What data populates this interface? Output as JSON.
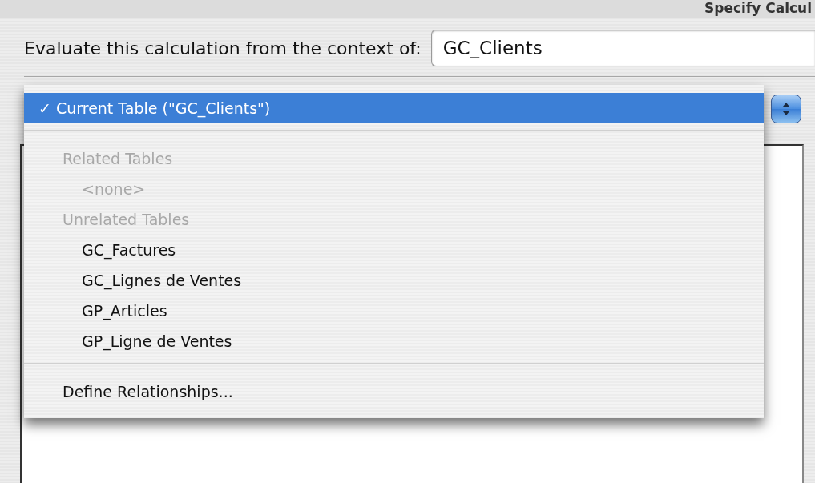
{
  "window": {
    "title": "Specify Calcul"
  },
  "context": {
    "label": "Evaluate this calculation from the context of:",
    "value": "GC_Clients"
  },
  "popup_menu": {
    "items": [
      {
        "kind": "item",
        "label": "✓ Current Table (\"GC_Clients\")",
        "selected": true
      },
      {
        "kind": "separator"
      },
      {
        "kind": "group",
        "label": "Related Tables",
        "disabled": true,
        "children": [
          {
            "label": "<none>",
            "disabled": true,
            "selected": false
          }
        ]
      },
      {
        "kind": "group",
        "label": "Unrelated Tables",
        "disabled": true,
        "children": [
          {
            "label": "GC_Factures",
            "disabled": false,
            "selected": false
          },
          {
            "label": "GC_Lignes de Ventes",
            "disabled": false,
            "selected": false
          },
          {
            "label": "GP_Articles",
            "disabled": false,
            "selected": false
          },
          {
            "label": "GP_Ligne de Ventes",
            "disabled": false,
            "selected": false
          }
        ]
      },
      {
        "kind": "separator"
      },
      {
        "kind": "command",
        "label": "Define Relationships...",
        "selected": false
      }
    ]
  }
}
